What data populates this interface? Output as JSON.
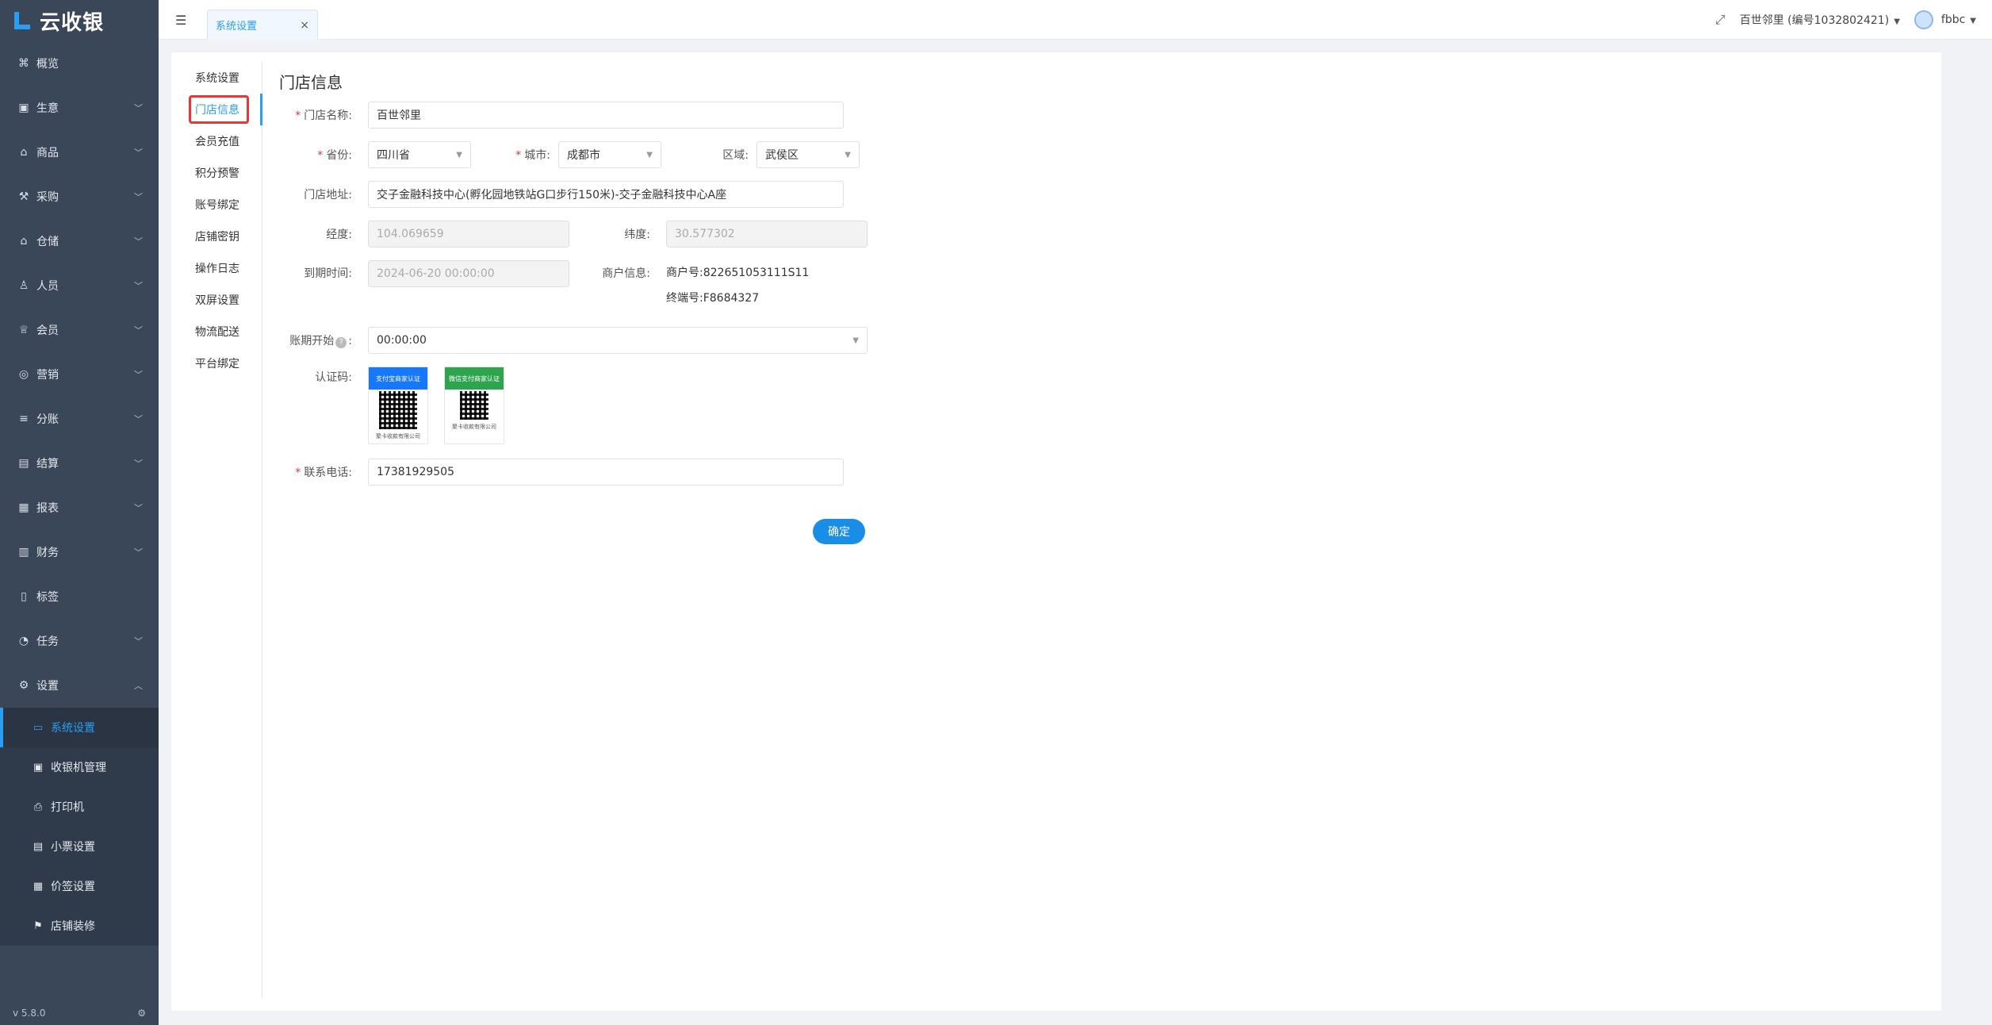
{
  "app": {
    "name": "云收银",
    "version": "v 5.8.0"
  },
  "sidebar": {
    "items": [
      {
        "label": "概览",
        "icon": "overview-icon",
        "glyph": "⌘",
        "has_children": false
      },
      {
        "label": "生意",
        "icon": "business-icon",
        "glyph": "▣",
        "has_children": true
      },
      {
        "label": "商品",
        "icon": "goods-icon",
        "glyph": "⌂",
        "has_children": true
      },
      {
        "label": "采购",
        "icon": "purchase-icon",
        "glyph": "⚒",
        "has_children": true
      },
      {
        "label": "仓储",
        "icon": "warehouse-icon",
        "glyph": "⌂",
        "has_children": true
      },
      {
        "label": "人员",
        "icon": "staff-icon",
        "glyph": "♙",
        "has_children": true
      },
      {
        "label": "会员",
        "icon": "member-icon",
        "glyph": "♕",
        "has_children": true
      },
      {
        "label": "营销",
        "icon": "marketing-icon",
        "glyph": "◎",
        "has_children": true
      },
      {
        "label": "分账",
        "icon": "split-icon",
        "glyph": "≡",
        "has_children": true
      },
      {
        "label": "结算",
        "icon": "settlement-icon",
        "glyph": "▤",
        "has_children": true
      },
      {
        "label": "报表",
        "icon": "report-icon",
        "glyph": "▦",
        "has_children": true
      },
      {
        "label": "财务",
        "icon": "finance-icon",
        "glyph": "▥",
        "has_children": true
      },
      {
        "label": "标签",
        "icon": "tag-icon",
        "glyph": "▯",
        "has_children": false
      },
      {
        "label": "任务",
        "icon": "task-icon",
        "glyph": "◔",
        "has_children": true
      },
      {
        "label": "设置",
        "icon": "settings-icon",
        "glyph": "⚙",
        "has_children": true,
        "expanded": true
      }
    ],
    "settings_children": [
      {
        "label": "系统设置",
        "icon": "monitor-icon",
        "glyph": "▭",
        "active": true
      },
      {
        "label": "收银机管理",
        "icon": "cashier-icon",
        "glyph": "▣"
      },
      {
        "label": "打印机",
        "icon": "printer-icon",
        "glyph": "⎙"
      },
      {
        "label": "小票设置",
        "icon": "receipt-icon",
        "glyph": "▤"
      },
      {
        "label": "价签设置",
        "icon": "price-tag-icon",
        "glyph": "▦"
      },
      {
        "label": "店铺装修",
        "icon": "decorate-icon",
        "glyph": "⚑"
      }
    ]
  },
  "topbar": {
    "tab_label": "系统设置",
    "store_label": "百世邻里 (编号1032802421)",
    "user_name": "fbbc"
  },
  "settings_nav": [
    {
      "label": "系统设置"
    },
    {
      "label": "门店信息",
      "active": true
    },
    {
      "label": "会员充值"
    },
    {
      "label": "积分预警"
    },
    {
      "label": "账号绑定"
    },
    {
      "label": "店铺密钥"
    },
    {
      "label": "操作日志"
    },
    {
      "label": "双屏设置"
    },
    {
      "label": "物流配送"
    },
    {
      "label": "平台绑定"
    }
  ],
  "form": {
    "title": "门店信息",
    "store_name_label": "门店名称:",
    "store_name_value": "百世邻里",
    "province_label": "省份:",
    "province_value": "四川省",
    "city_label": "城市:",
    "city_value": "成都市",
    "district_label": "区域:",
    "district_value": "武侯区",
    "address_label": "门店地址:",
    "address_value": "交子金融科技中心(孵化园地铁站G口步行150米)-交子金融科技中心A座",
    "longitude_label": "经度:",
    "longitude_value": "104.069659",
    "latitude_label": "纬度:",
    "latitude_value": "30.577302",
    "expire_label": "到期时间:",
    "expire_value": "2024-06-20 00:00:00",
    "merchant_label": "商户信息:",
    "merchant_no": "商户号:822651053111S11",
    "terminal_no": "终端号:F8684327",
    "period_label_prefix": "账期开始",
    "period_label_suffix": ":",
    "period_value": "00:00:00",
    "cert_label": "认证码:",
    "qr1_head": "支付宝商家认证",
    "qr1_foot": "聚卡收款有限公司",
    "qr2_head": "微信支付商家认证",
    "qr2_foot": "聚卡收款有限公司",
    "phone_label": "联系电话:",
    "phone_value": "17381929505",
    "submit_label": "确定"
  },
  "colors": {
    "accent": "#2a9df4",
    "sidebar_bg": "#3a4759",
    "highlight_border": "#e53935",
    "qr1_head": "#1677ff",
    "qr2_head": "#2ea44f"
  }
}
